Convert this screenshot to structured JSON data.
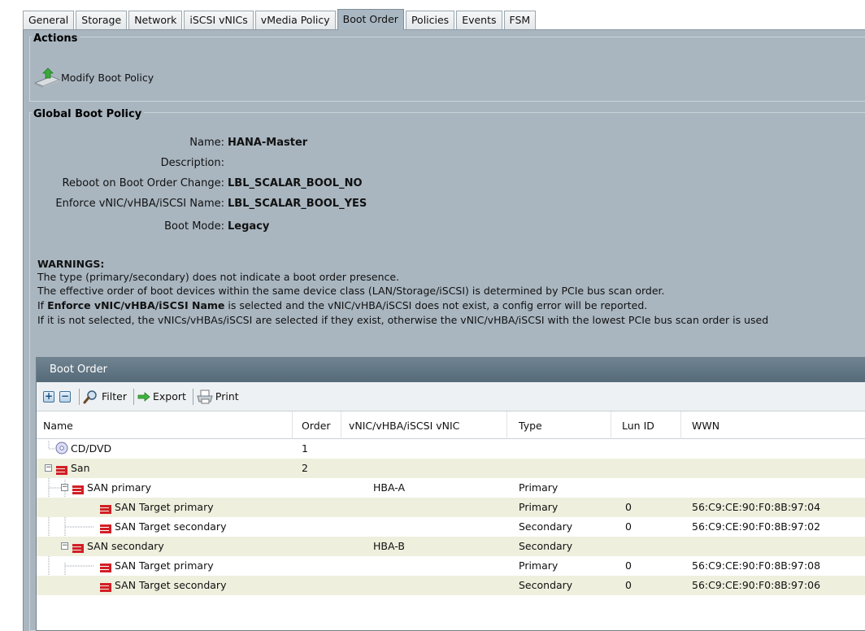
{
  "tabs": [
    "General",
    "Storage",
    "Network",
    "iSCSI vNICs",
    "vMedia Policy",
    "Boot Order",
    "Policies",
    "Events",
    "FSM"
  ],
  "active_tab": "Boot Order",
  "actions": {
    "legend": "Actions",
    "modify_label": "Modify Boot Policy"
  },
  "global": {
    "legend": "Global Boot Policy",
    "name_label": "Name:",
    "name_value": "HANA-Master",
    "description_label": "Description:",
    "description_value": "",
    "reboot_label": "Reboot on Boot Order Change:",
    "reboot_value": "LBL_SCALAR_BOOL_NO",
    "enforce_label": "Enforce vNIC/vHBA/iSCSI Name:",
    "enforce_value": "LBL_SCALAR_BOOL_YES",
    "bootmode_label": "Boot Mode:",
    "bootmode_value": "Legacy"
  },
  "warnings": {
    "title": "WARNINGS:",
    "line1": "The type (primary/secondary) does not indicate a boot order presence.",
    "line2": "The effective order of boot devices within the same device class (LAN/Storage/iSCSI) is determined by PCIe bus scan order.",
    "line3_pre": "If ",
    "line3_bold": "Enforce vNIC/vHBA/iSCSI Name",
    "line3_post": " is selected and the vNIC/vHBA/iSCSI does not exist, a config error will be reported.",
    "line4": "If it is not selected, the vNICs/vHBAs/iSCSI are selected if they exist, otherwise the vNIC/vHBA/iSCSI with the lowest PCIe bus scan order is used"
  },
  "boot_order": {
    "title": "Boot Order",
    "toolbar": {
      "filter": "Filter",
      "export": "Export",
      "print": "Print"
    },
    "columns": [
      "Name",
      "Order",
      "vNIC/vHBA/iSCSI vNIC",
      "Type",
      "Lun ID",
      "WWN"
    ],
    "rows": [
      {
        "name": "CD/DVD",
        "order": "1",
        "vnic": "",
        "type": "",
        "lun": "",
        "wwn": ""
      },
      {
        "name": "San",
        "order": "2",
        "vnic": "",
        "type": "",
        "lun": "",
        "wwn": ""
      },
      {
        "name": "SAN primary",
        "order": "",
        "vnic": "HBA-A",
        "type": "Primary",
        "lun": "",
        "wwn": ""
      },
      {
        "name": "SAN Target primary",
        "order": "",
        "vnic": "",
        "type": "Primary",
        "lun": "0",
        "wwn": "56:C9:CE:90:F0:8B:97:04"
      },
      {
        "name": "SAN Target secondary",
        "order": "",
        "vnic": "",
        "type": "Secondary",
        "lun": "0",
        "wwn": "56:C9:CE:90:F0:8B:97:02"
      },
      {
        "name": "SAN secondary",
        "order": "",
        "vnic": "HBA-B",
        "type": "Secondary",
        "lun": "",
        "wwn": ""
      },
      {
        "name": "SAN Target primary",
        "order": "",
        "vnic": "",
        "type": "Primary",
        "lun": "0",
        "wwn": "56:C9:CE:90:F0:8B:97:08"
      },
      {
        "name": "SAN Target secondary",
        "order": "",
        "vnic": "",
        "type": "Secondary",
        "lun": "0",
        "wwn": "56:C9:CE:90:F0:8B:97:06"
      }
    ]
  }
}
